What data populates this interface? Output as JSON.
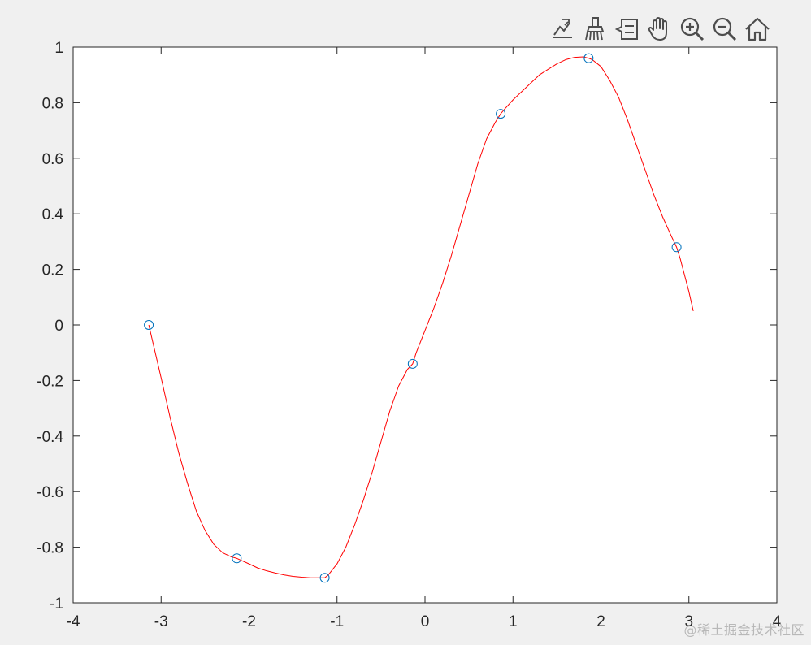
{
  "toolbar": {
    "items": [
      {
        "name": "edit-plot",
        "icon": "edit-plot-icon"
      },
      {
        "name": "brush",
        "icon": "brush-icon"
      },
      {
        "name": "data-tips",
        "icon": "data-tips-icon"
      },
      {
        "name": "pan",
        "icon": "hand-icon"
      },
      {
        "name": "zoom-in",
        "icon": "zoom-in-icon"
      },
      {
        "name": "zoom-out",
        "icon": "zoom-out-icon"
      },
      {
        "name": "restore-view",
        "icon": "home-icon"
      }
    ],
    "icon_color": "#4d4d4d"
  },
  "chart_data": {
    "type": "line",
    "title": "",
    "xlabel": "",
    "ylabel": "",
    "xlim": [
      -4,
      4
    ],
    "ylim": [
      -1,
      1
    ],
    "xticks": [
      "-4",
      "-3",
      "-2",
      "-1",
      "0",
      "1",
      "2",
      "3",
      "4"
    ],
    "yticks": [
      "1",
      "0.8",
      "0.6",
      "0.4",
      "0.2",
      "0",
      "-0.2",
      "-0.4",
      "-0.6",
      "-0.8",
      "-1"
    ],
    "grid": false,
    "series": [
      {
        "kind": "markers",
        "marker": "circle",
        "color": "#0072bd",
        "x": [
          -3.14,
          -2.14,
          -1.14,
          -0.14,
          0.86,
          1.86,
          2.86
        ],
        "y": [
          0.0,
          -0.84,
          -0.91,
          -0.14,
          0.76,
          0.96,
          0.28
        ]
      },
      {
        "kind": "line",
        "color": "#ff0000",
        "x": [
          -3.14,
          -3.0,
          -2.9,
          -2.8,
          -2.7,
          -2.6,
          -2.5,
          -2.4,
          -2.3,
          -2.2,
          -2.14,
          -2.0,
          -1.9,
          -1.8,
          -1.7,
          -1.6,
          -1.5,
          -1.4,
          -1.3,
          -1.2,
          -1.14,
          -1.1,
          -1.0,
          -0.9,
          -0.8,
          -0.7,
          -0.6,
          -0.5,
          -0.4,
          -0.3,
          -0.2,
          -0.14,
          -0.1,
          0.0,
          0.1,
          0.2,
          0.3,
          0.4,
          0.5,
          0.6,
          0.7,
          0.8,
          0.86,
          0.9,
          1.0,
          1.1,
          1.2,
          1.3,
          1.4,
          1.5,
          1.6,
          1.7,
          1.8,
          1.86,
          1.9,
          2.0,
          2.1,
          2.2,
          2.3,
          2.4,
          2.5,
          2.6,
          2.7,
          2.8,
          2.86,
          2.9,
          3.0,
          3.05
        ],
        "y": [
          0.0,
          -0.19,
          -0.33,
          -0.46,
          -0.57,
          -0.67,
          -0.74,
          -0.79,
          -0.82,
          -0.835,
          -0.84,
          -0.86,
          -0.875,
          -0.885,
          -0.893,
          -0.9,
          -0.905,
          -0.908,
          -0.91,
          -0.91,
          -0.91,
          -0.9,
          -0.86,
          -0.8,
          -0.72,
          -0.63,
          -0.53,
          -0.42,
          -0.31,
          -0.22,
          -0.16,
          -0.14,
          -0.1,
          -0.02,
          0.06,
          0.15,
          0.25,
          0.36,
          0.47,
          0.58,
          0.67,
          0.73,
          0.76,
          0.775,
          0.81,
          0.84,
          0.87,
          0.9,
          0.92,
          0.94,
          0.955,
          0.963,
          0.965,
          0.96,
          0.955,
          0.93,
          0.88,
          0.82,
          0.74,
          0.65,
          0.56,
          0.47,
          0.39,
          0.32,
          0.28,
          0.24,
          0.12,
          0.05
        ]
      }
    ]
  },
  "watermark": "@稀土掘金技术社区"
}
